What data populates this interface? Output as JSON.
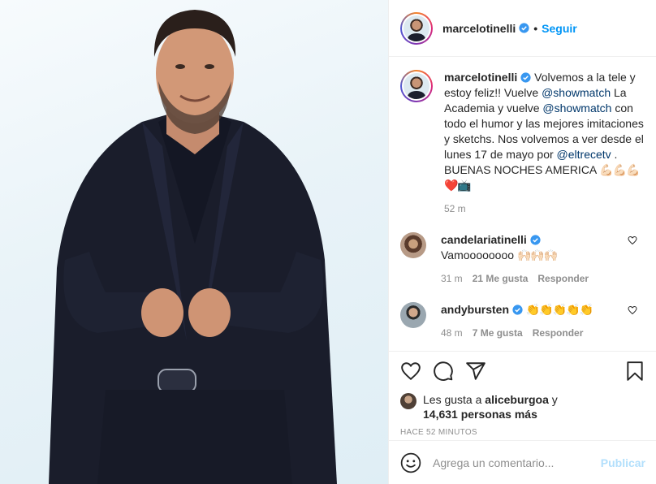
{
  "post": {
    "username": "marcelotinelli",
    "follow_label": "Seguir",
    "dot": "•",
    "caption": {
      "part1": " Volvemos a la tele y estoy feliz!! Vuelve ",
      "mention1": "@showmatch",
      "part2": " La Academia y vuelve ",
      "mention2": "@showmatch",
      "part3": " con todo el humor y las mejores imitaciones y sketchs. Nos volvemos a ver desde el lunes 17 de mayo por ",
      "mention3": "@eltrecetv",
      "part4": " . BUENAS NOCHES AMERICA ",
      "emojis": "💪🏻💪🏻💪🏻❤️📺"
    },
    "caption_time": "52 m"
  },
  "comments": [
    {
      "username": "candelariatinelli",
      "verified": true,
      "text": "Vamoooooooo ",
      "emojis": "🙌🏻🙌🏻🙌🏻",
      "time": "31 m",
      "likes": "21 Me gusta",
      "reply": "Responder"
    },
    {
      "username": "andybursten",
      "verified": true,
      "text": " ",
      "emojis": "👏👏👏👏👏",
      "time": "48 m",
      "likes": "7 Me gusta",
      "reply": "Responder"
    }
  ],
  "actions": {
    "likes_prefix": "Les gusta a ",
    "likes_user": "aliceburgoa",
    "likes_and": " y",
    "likes_count": "14,631 personas más",
    "time_ago": "HACE 52 MINUTOS"
  },
  "composer": {
    "placeholder": "Agrega un comentario...",
    "publish_label": "Publicar"
  },
  "colors": {
    "accent": "#0095f6",
    "muted": "#8e8e8e",
    "mention": "#00376b",
    "publish_disabled": "#b2dffc"
  },
  "icons": [
    "heart-icon",
    "comment-icon",
    "share-icon",
    "bookmark-icon",
    "smile-icon",
    "verified-icon"
  ]
}
